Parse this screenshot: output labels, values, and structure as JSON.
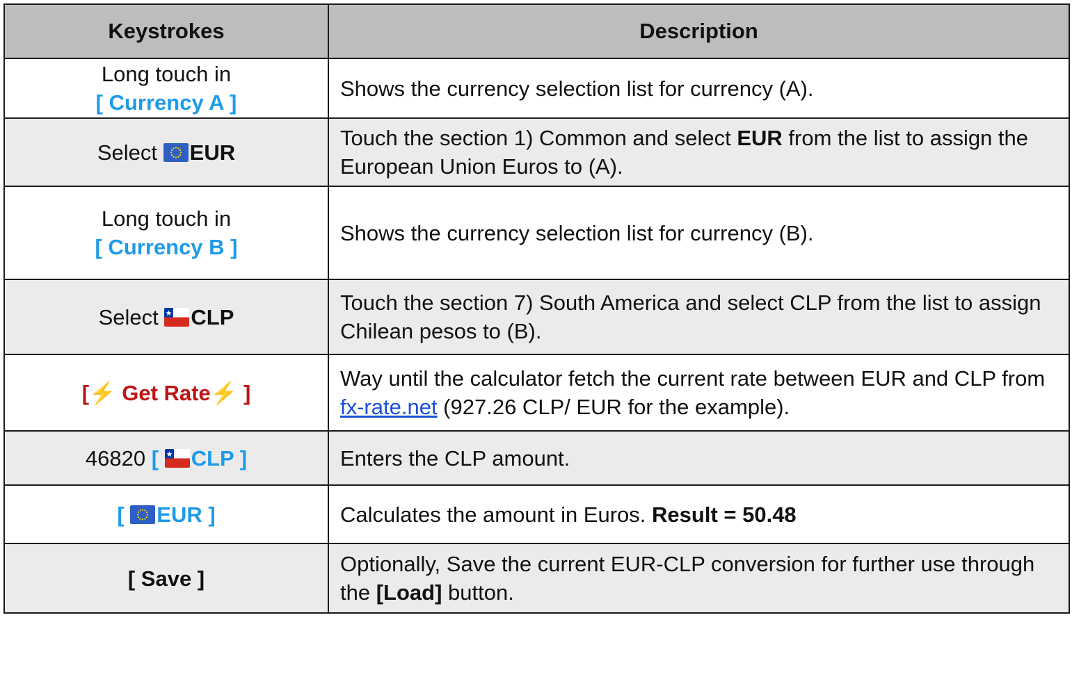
{
  "headers": {
    "keystrokes": "Keystrokes",
    "description": "Description"
  },
  "rows": [
    {
      "key": {
        "line1": "Long touch in",
        "button": "[ Currency A ]"
      },
      "desc": {
        "text": "Shows the currency selection list for currency (A)."
      }
    },
    {
      "key": {
        "prefix": "Select",
        "flag": "eu-flag-icon",
        "code": "EUR"
      },
      "desc": {
        "pre": "Touch the section 1) Common  and select ",
        "bold": "EUR",
        "post": " from the list to assign the European Union Euros to (A)."
      }
    },
    {
      "key": {
        "line1": "Long touch in",
        "button": "[ Currency B ]"
      },
      "desc": {
        "text": "Shows the currency selection list for currency (B)."
      }
    },
    {
      "key": {
        "prefix": "Select",
        "flag": "chile-flag-icon",
        "code": "CLP"
      },
      "desc": {
        "text": "Touch the section 7) South America  and select CLP from the list to assign Chilean pesos to (B)."
      }
    },
    {
      "key": {
        "open": "[",
        "bolt": "⚡",
        "label": "Get Rate",
        "close": "]"
      },
      "desc": {
        "pre": "Way until the calculator fetch the current rate between EUR and CLP from ",
        "link": "fx-rate.net",
        "post": " (927.26 CLP/ EUR for the example)."
      }
    },
    {
      "key": {
        "number": "46820",
        "open": "[",
        "flag": "chile-flag-icon",
        "code": "CLP",
        "close": "]"
      },
      "desc": {
        "text": "Enters the CLP amount."
      }
    },
    {
      "key": {
        "open": "[",
        "flag": "eu-flag-icon",
        "code": "EUR",
        "close": "]"
      },
      "desc": {
        "pre": "Calculates the amount in Euros. ",
        "bold": "Result = 50.48"
      }
    },
    {
      "key": {
        "label": "[ Save ]"
      },
      "desc": {
        "pre": "Optionally, Save the current EUR-CLP conversion for further use through the ",
        "bold": "[Load]",
        "post": " button."
      }
    }
  ],
  "colors": {
    "header_bg": "#bdbdbd",
    "alt_row_bg": "#ebebeb",
    "key_blue": "#1e9be8",
    "key_red": "#c11414",
    "bolt_yellow": "#f3c21b",
    "link_blue": "#1a4fd8"
  }
}
